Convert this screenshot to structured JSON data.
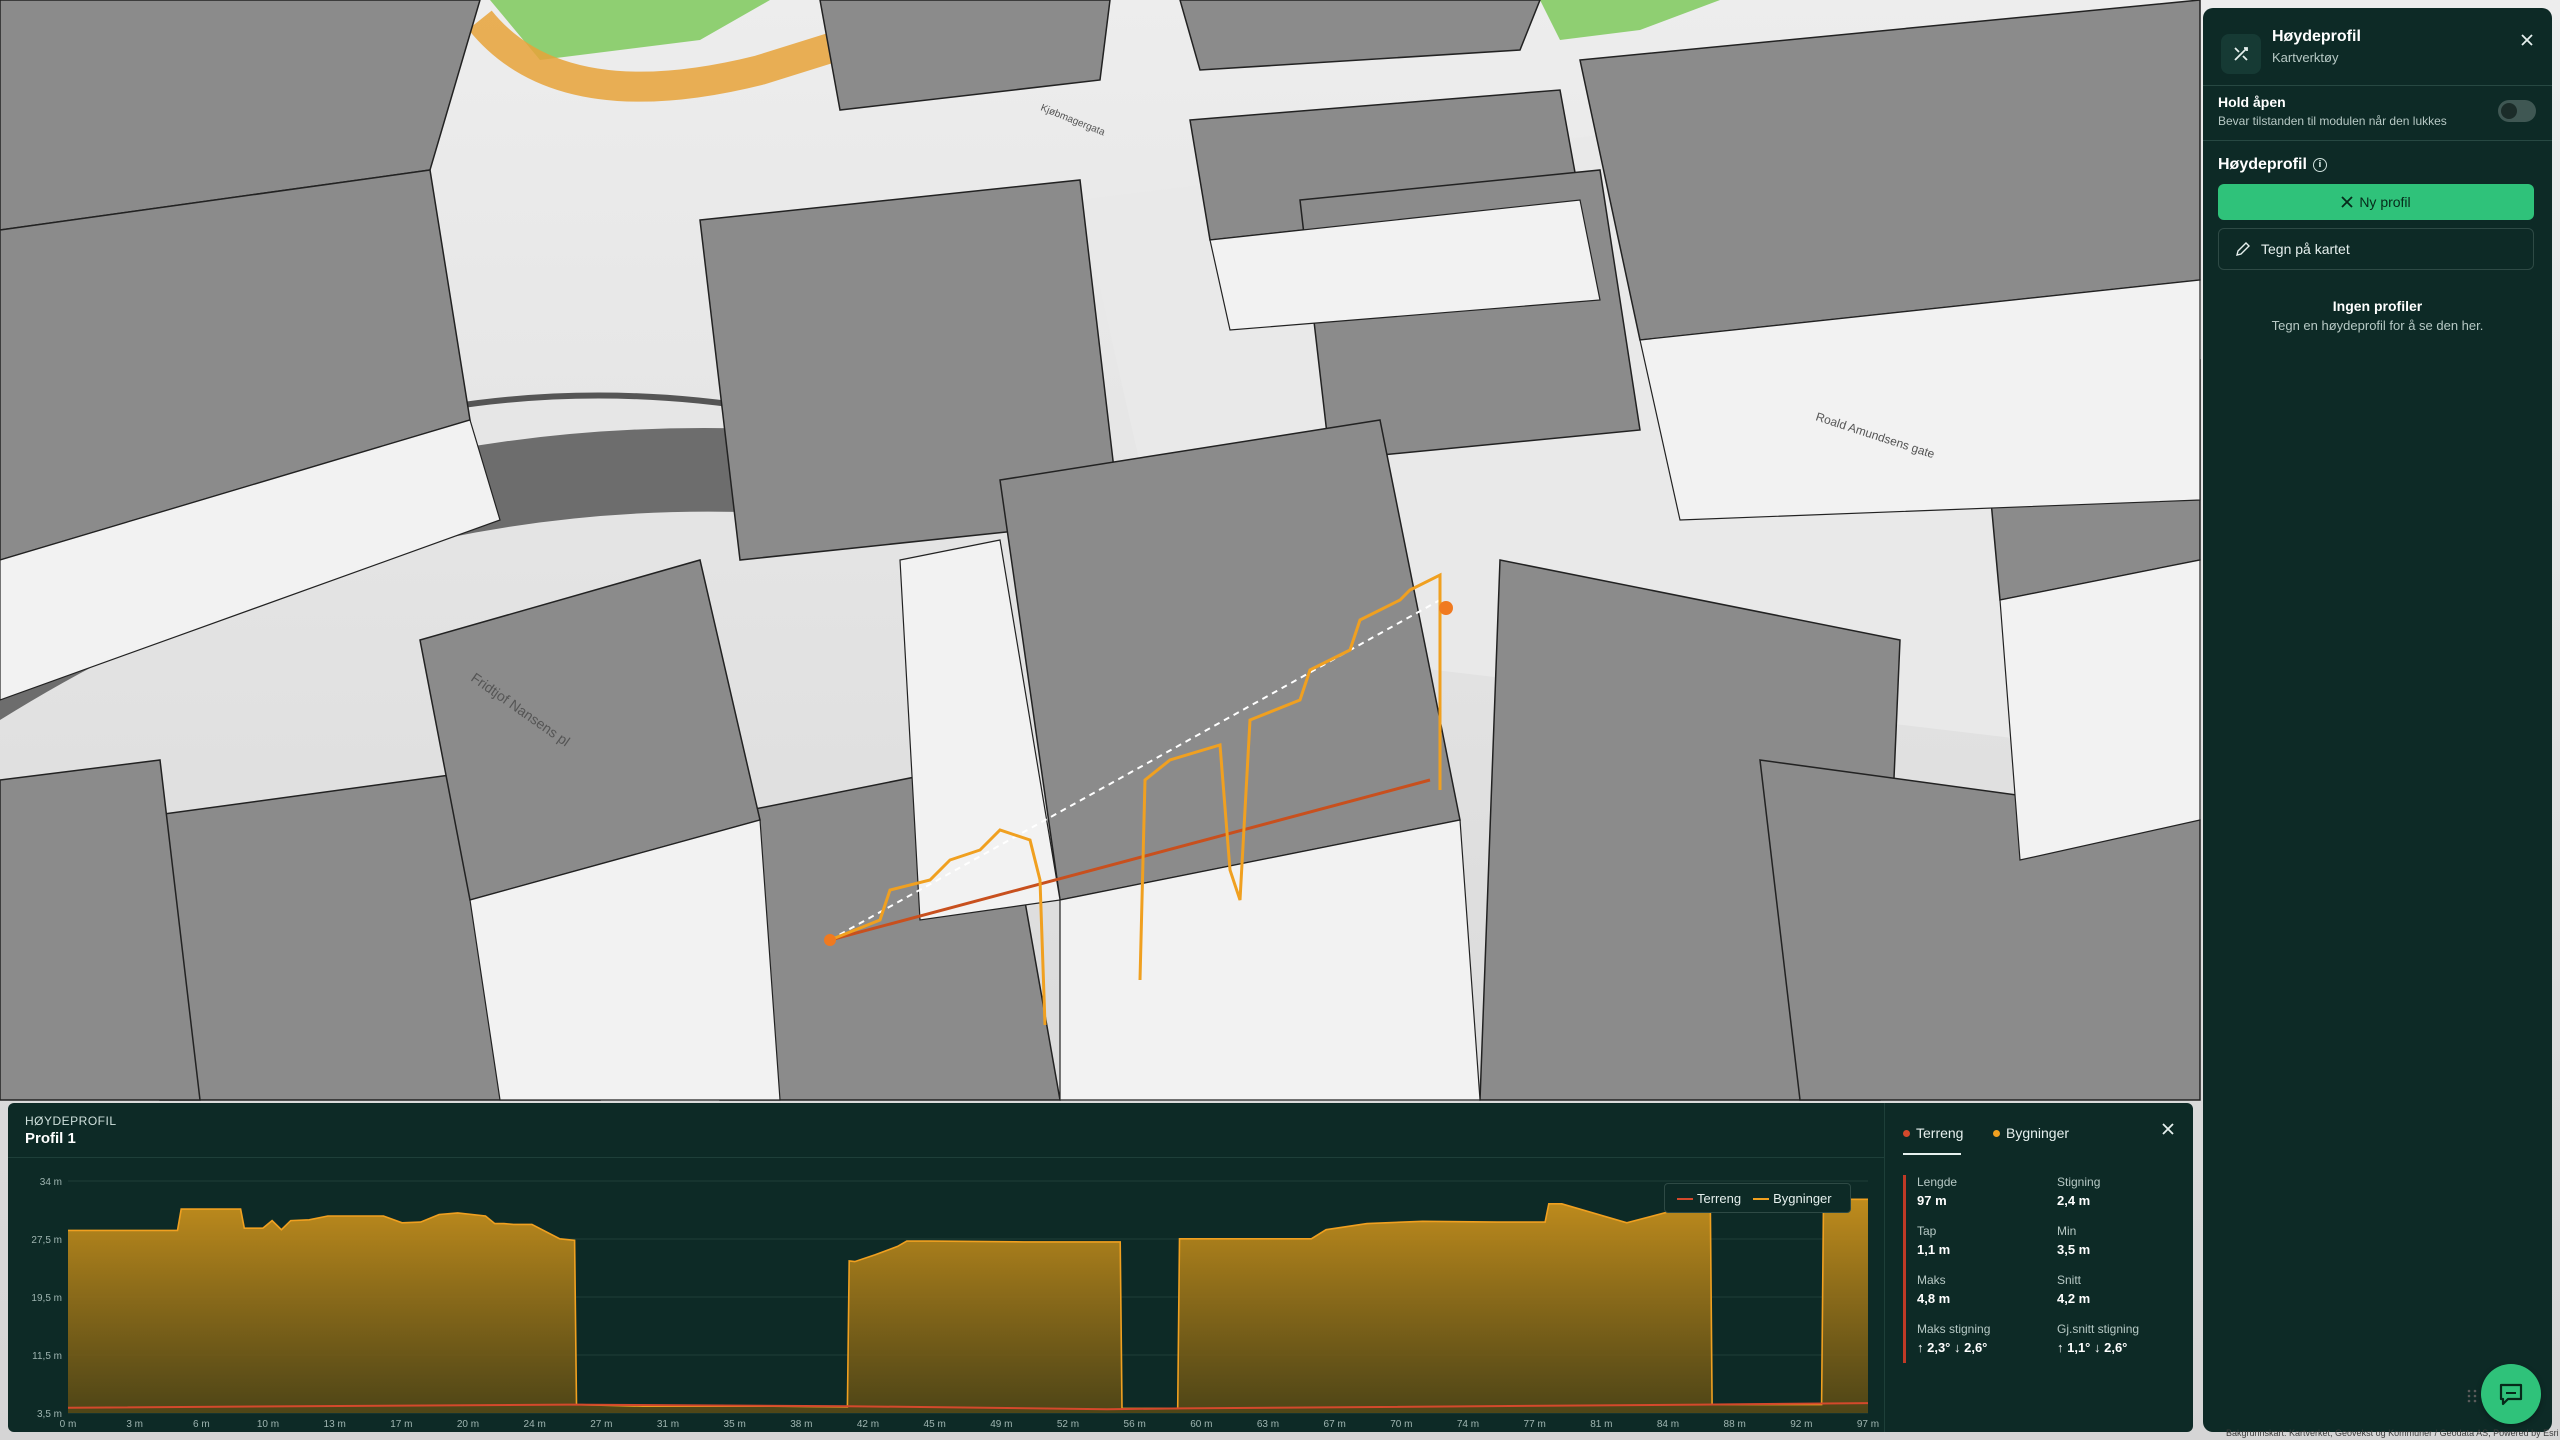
{
  "panel": {
    "title": "Høydeprofil",
    "subtitle": "Kartverktøy",
    "hold_open_label": "Hold åpen",
    "hold_open_desc": "Bevar tilstanden til modulen når den lukkes",
    "hold_open_on": false,
    "section_title": "Høydeprofil",
    "new_profile_label": "Ny profil",
    "draw_label": "Tegn på kartet",
    "empty_title": "Ingen profiler",
    "empty_desc": "Tegn en høydeprofil for å se den her."
  },
  "map": {
    "street_labels": [
      "Fridtjof Nansens pl",
      "Roald Amundsens gate",
      "Kjøbmagergata"
    ],
    "colors": {
      "route_orange": "#f0a020",
      "terrain_line": "#c8501e",
      "ground": "#e4e4e4",
      "building": "#8a8a8a",
      "grass": "#8fcf72"
    }
  },
  "profile": {
    "kicker": "HØYDEPROFIL",
    "title": "Profil 1",
    "tabs": [
      {
        "label": "Terreng",
        "color": "#d4492c"
      },
      {
        "label": "Bygninger",
        "color": "#f0a020"
      }
    ],
    "stats": [
      {
        "label": "Lengde",
        "value": "97 m"
      },
      {
        "label": "Stigning",
        "value": "2,4 m"
      },
      {
        "label": "Tap",
        "value": "1,1 m"
      },
      {
        "label": "Min",
        "value": "3,5 m"
      },
      {
        "label": "Maks",
        "value": "4,8 m"
      },
      {
        "label": "Snitt",
        "value": "4,2 m"
      },
      {
        "label": "Maks stigning",
        "value": "↑ 2,3° ↓ 2,6°"
      },
      {
        "label": "Gj.snitt stigning",
        "value": "↑ 1,1° ↓ 2,6°"
      }
    ]
  },
  "chart_data": {
    "type": "area",
    "xlabel": "",
    "ylabel": "",
    "yticks": [
      "34 m",
      "27,5 m",
      "19,5 m",
      "11,5 m",
      "3,5 m"
    ],
    "xticks": [
      "0 m",
      "3 m",
      "6 m",
      "10 m",
      "13 m",
      "17 m",
      "20 m",
      "24 m",
      "27 m",
      "31 m",
      "35 m",
      "38 m",
      "42 m",
      "45 m",
      "49 m",
      "52 m",
      "56 m",
      "60 m",
      "63 m",
      "67 m",
      "70 m",
      "74 m",
      "77 m",
      "81 m",
      "84 m",
      "88 m",
      "92 m",
      "97 m"
    ],
    "ylim": [
      3.5,
      34
    ],
    "xlim": [
      0,
      97
    ],
    "legend": "top-right",
    "series": [
      {
        "name": "Terreng",
        "color": "#d4492c",
        "x": [
          0,
          27,
          42,
          56,
          60,
          88,
          97
        ],
        "y": [
          4.2,
          4.6,
          4.4,
          4.0,
          4.1,
          4.6,
          4.8
        ]
      },
      {
        "name": "Bygninger",
        "color": "#f0a020",
        "x": [
          0,
          5.9,
          6.1,
          9.3,
          9.5,
          10.5,
          11,
          11.5,
          12,
          13,
          14,
          17,
          18,
          19,
          20,
          21,
          22.5,
          23,
          23.5,
          24,
          25,
          26.5,
          27.3,
          27.4,
          31,
          38,
          42,
          42.1,
          42.4,
          43.5,
          44.7,
          45.2,
          46.5,
          51.5,
          56.7,
          56.8,
          59.8,
          59.9,
          67,
          67.8,
          70,
          73,
          77,
          79.6,
          79.8,
          80.5,
          84,
          88.5,
          88.6,
          94.5,
          94.6,
          97
        ],
        "y": [
          27.5,
          27.5,
          30.3,
          30.3,
          27.8,
          27.8,
          28.8,
          27.6,
          28.8,
          28.9,
          29.4,
          29.4,
          28.5,
          28.6,
          29.6,
          29.8,
          29.4,
          28.4,
          28.4,
          28.3,
          28.3,
          26.4,
          26.2,
          4.6,
          4.4,
          4.4,
          4.3,
          23.5,
          23.4,
          24.3,
          25.4,
          26.1,
          26.1,
          26.0,
          26.0,
          4.1,
          4.1,
          26.4,
          26.4,
          27.6,
          28.4,
          28.7,
          28.6,
          28.6,
          31,
          31,
          28.5,
          31.4,
          4.6,
          4.6,
          31.6,
          31.6
        ]
      }
    ]
  },
  "footer": {
    "attribution": "Bakgrunnskart: Kartverket, Geovekst og Kommuner / Geodata AS, Powered by Esri"
  }
}
